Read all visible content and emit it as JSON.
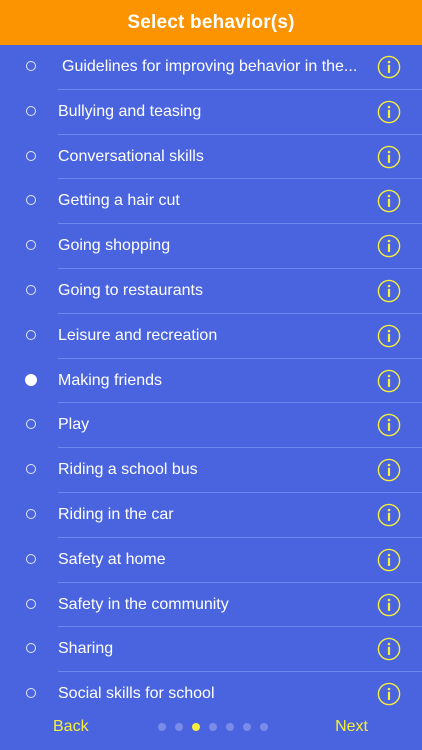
{
  "header": {
    "title": "Select behavior(s)"
  },
  "colors": {
    "background": "#4a64e0",
    "header": "#fb9400",
    "accent": "#f7ef3a",
    "text": "#ffffff"
  },
  "icons": {
    "info": "info-circle-icon",
    "radio": "radio-button-icon"
  },
  "behaviors": [
    {
      "label": "Guidelines for improving behavior in the...",
      "selected": false
    },
    {
      "label": "Bullying and teasing",
      "selected": false
    },
    {
      "label": "Conversational skills",
      "selected": false
    },
    {
      "label": "Getting a hair cut",
      "selected": false
    },
    {
      "label": "Going shopping",
      "selected": false
    },
    {
      "label": "Going to restaurants",
      "selected": false
    },
    {
      "label": "Leisure and recreation",
      "selected": false
    },
    {
      "label": "Making friends",
      "selected": true
    },
    {
      "label": "Play",
      "selected": false
    },
    {
      "label": "Riding a school bus",
      "selected": false
    },
    {
      "label": "Riding in the car",
      "selected": false
    },
    {
      "label": "Safety at home",
      "selected": false
    },
    {
      "label": "Safety in the community",
      "selected": false
    },
    {
      "label": "Sharing",
      "selected": false
    },
    {
      "label": "Social skills for school",
      "selected": false
    }
  ],
  "footer": {
    "back_label": "Back",
    "next_label": "Next",
    "page_count": 7,
    "current_page": 3
  }
}
